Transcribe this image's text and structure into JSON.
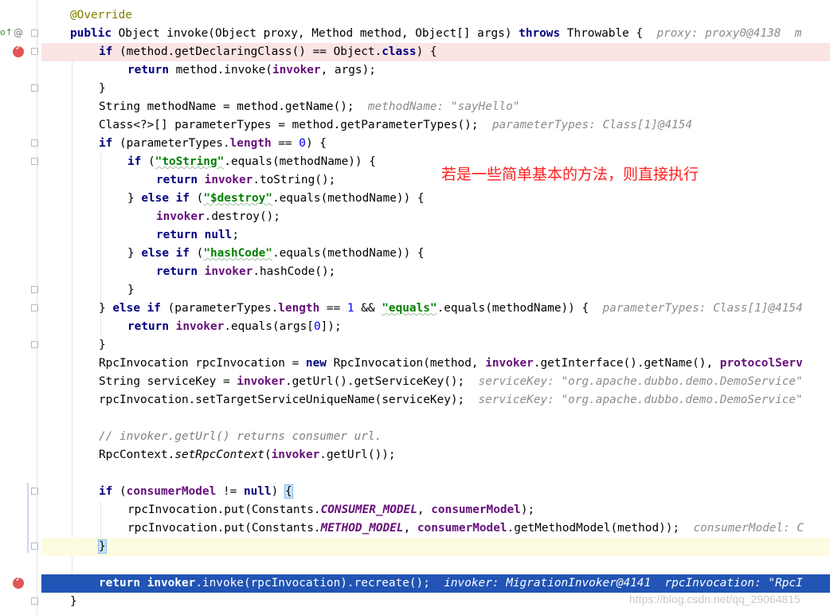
{
  "gutter": {
    "override_marker": "o↑",
    "annotation_marker": "@"
  },
  "lines": {
    "l1": "@Override",
    "l2_kw": "public",
    "l2_code": " Object invoke(Object proxy, Method method, Object[] args) ",
    "l2_kw2": "throws",
    "l2_code2": " Throwable {  ",
    "l2_hint": "proxy: proxy0@4138  m",
    "l3_kw": "if",
    "l3_code": " (method.getDeclaringClass() == Object.",
    "l3_kw2": "class",
    "l3_code2": ") {",
    "l4_kw": "return",
    "l4_code": " method.invoke(",
    "l4_fld": "invoker",
    "l4_code2": ", args);",
    "l5": "}",
    "l6_code": "String methodName = method.getName();  ",
    "l6_hint": "methodName: \"sayHello\"",
    "l7_code": "Class<?>[] parameterTypes = method.getParameterTypes();  ",
    "l7_hint": "parameterTypes: Class[1]@4154",
    "l8_kw": "if",
    "l8_code": " (parameterTypes.",
    "l8_fld": "length",
    "l8_code2": " == ",
    "l8_num": "0",
    "l8_code3": ") {",
    "l9_kw": "if",
    "l9_code": " (",
    "l9_str": "\"toString\"",
    "l9_code2": ".equals(methodName)) {",
    "l10_kw": "return",
    "l10_fld": "invoker",
    "l10_code": ".toString();",
    "l11_code": "} ",
    "l11_kw": "else if",
    "l11_code2": " (",
    "l11_str": "\"$destroy\"",
    "l11_code3": ".equals(methodName)) {",
    "l12_fld": "invoker",
    "l12_code": ".destroy();",
    "l13_kw": "return",
    "l13_kw2": "null",
    "l13_code": ";",
    "l14_code": "} ",
    "l14_kw": "else if",
    "l14_code2": " (",
    "l14_str": "\"hashCode\"",
    "l14_code3": ".equals(methodName)) {",
    "l15_kw": "return",
    "l15_fld": "invoker",
    "l15_code": ".hashCode();",
    "l16": "}",
    "l17_code": "} ",
    "l17_kw": "else if",
    "l17_code2": " (parameterTypes.",
    "l17_fld": "length",
    "l17_code3": " == ",
    "l17_num": "1",
    "l17_code4": " && ",
    "l17_str": "\"equals\"",
    "l17_code5": ".equals(methodName)) {  ",
    "l17_hint": "parameterTypes: Class[1]@4154",
    "l18_kw": "return",
    "l18_fld": "invoker",
    "l18_code": ".equals(args[",
    "l18_num": "0",
    "l18_code2": "]);",
    "l19": "}",
    "l20_code": "RpcInvocation rpcInvocation = ",
    "l20_kw": "new",
    "l20_code2": " RpcInvocation(method, ",
    "l20_fld": "invoker",
    "l20_code3": ".getInterface().getName(), ",
    "l20_fld2": "protocolServ",
    "l21_code": "String serviceKey = ",
    "l21_fld": "invoker",
    "l21_code2": ".getUrl().getServiceKey();  ",
    "l21_hint": "serviceKey: \"org.apache.dubbo.demo.DemoService\"",
    "l22_code": "rpcInvocation.setTargetServiceUniqueName(serviceKey);  ",
    "l22_hint": "serviceKey: \"org.apache.dubbo.demo.DemoService\"",
    "l24_cmt": "// invoker.getUrl() returns consumer url.",
    "l25_code": "RpcContext.",
    "l25_ital": "setRpcContext",
    "l25_code2": "(",
    "l25_fld": "invoker",
    "l25_code3": ".getUrl());",
    "l27_kw": "if",
    "l27_code": " (",
    "l27_fld": "consumerModel",
    "l27_code2": " != ",
    "l27_kw2": "null",
    "l27_code3": ") ",
    "l27_brace": "{",
    "l28_code": "rpcInvocation.put(Constants.",
    "l28_sfld": "CONSUMER_MODEL",
    "l28_code2": ", ",
    "l28_fld": "consumerModel",
    "l28_code3": ");",
    "l29_code": "rpcInvocation.put(Constants.",
    "l29_sfld": "METHOD_MODEL",
    "l29_code2": ", ",
    "l29_fld": "consumerModel",
    "l29_code3": ".getMethodModel(method));  ",
    "l29_hint": "consumerModel: C",
    "l30_brace": "}",
    "l32_kw": "return",
    "l32_fld": "invoker",
    "l32_code": ".invoke(rpcInvocation).recreate();  ",
    "l32_hint": "invoker: MigrationInvoker@4141  rpcInvocation: \"RpcI",
    "l33": "}"
  },
  "annotation_note": "若是一些简单基本的方法，则直接执行",
  "watermark": "https://blog.csdn.net/qq_29064815",
  "colors": {
    "keyword": "#000080",
    "string": "#008000",
    "field": "#660e7a",
    "annotation": "#808000",
    "breakpoint_line": "#fae4e4",
    "execution_line": "#2154b4",
    "note": "#ff2020"
  }
}
